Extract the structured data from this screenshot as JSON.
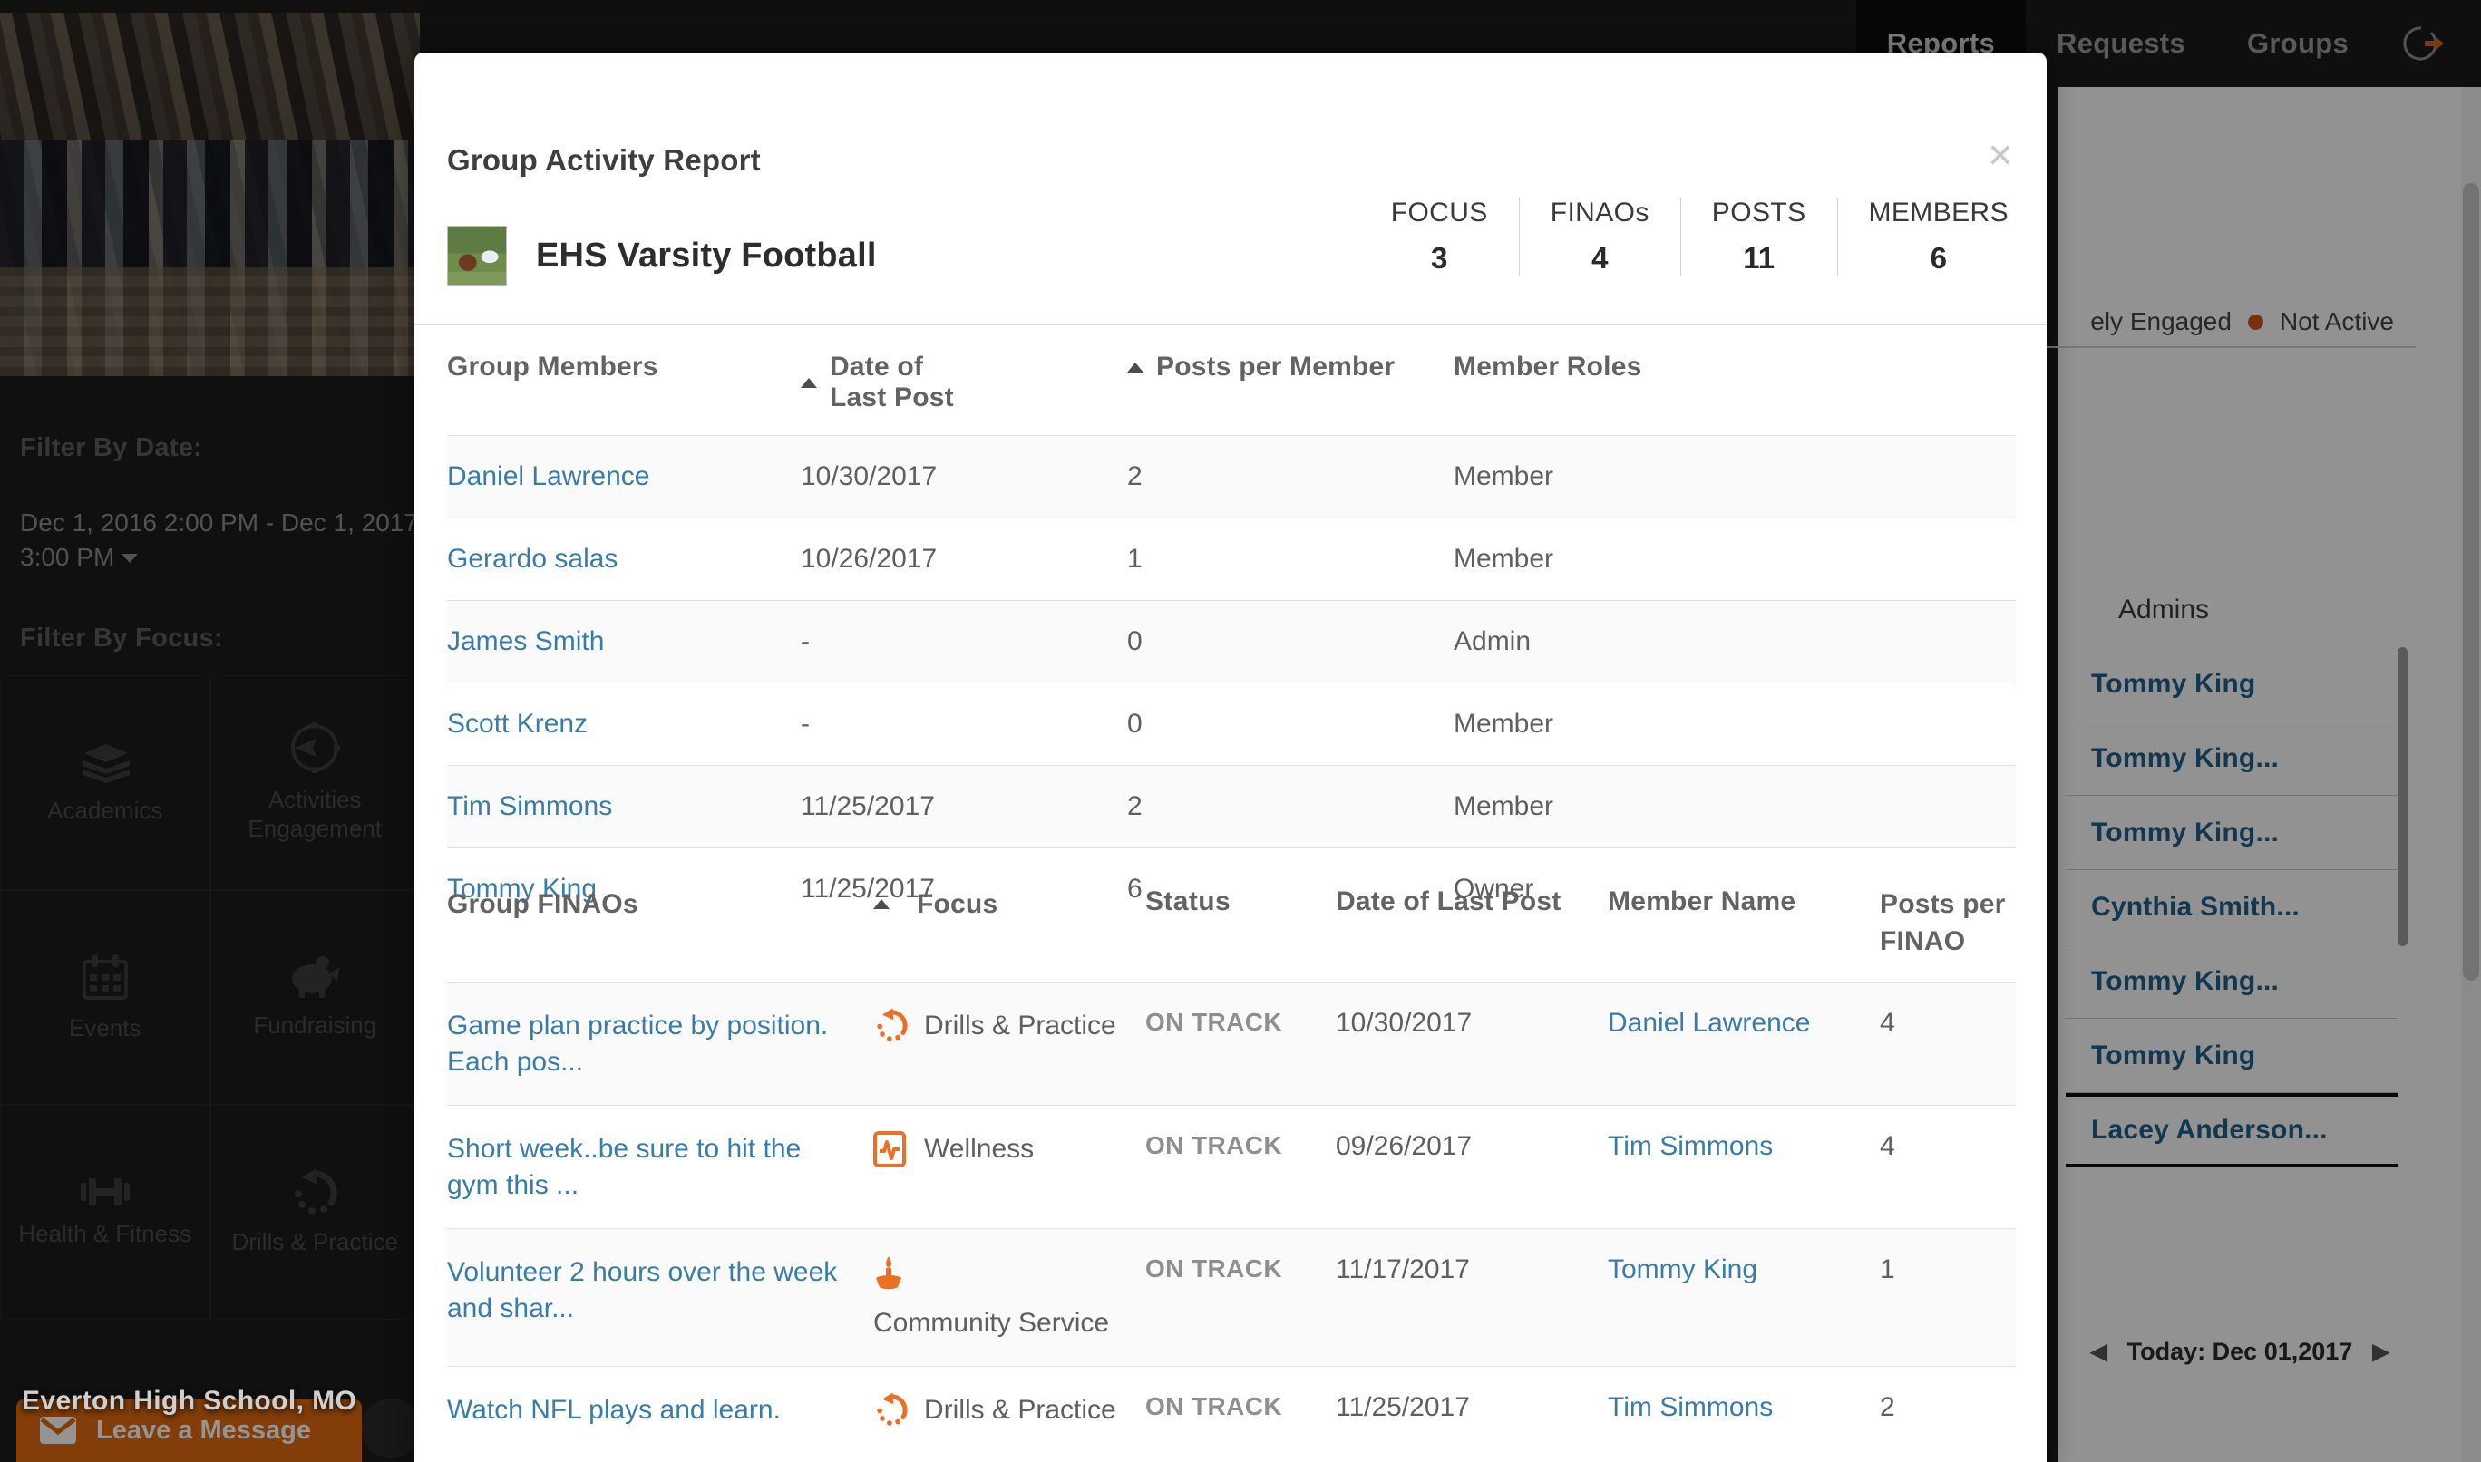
{
  "topnav": {
    "tabs": [
      {
        "label": "Reports",
        "active": true
      },
      {
        "label": "Requests",
        "active": false
      },
      {
        "label": "Groups",
        "active": false
      }
    ],
    "logout_icon": "logout-icon"
  },
  "left": {
    "banner_title": "Everton High School, MO",
    "filter_date_label": "Filter By Date:",
    "filter_date_value": "Dec 1, 2016 2:00 PM - Dec 1, 2017 3:00 PM",
    "filter_focus_label": "Filter By Focus:",
    "focus_items": [
      {
        "label": "Academics",
        "icon": "books-icon"
      },
      {
        "label": "Activities Engagement",
        "icon": "compass-icon"
      },
      {
        "label": "Events",
        "icon": "calendar-icon"
      },
      {
        "label": "Fundraising",
        "icon": "piggy-bank-icon"
      },
      {
        "label": "Health & Fitness",
        "icon": "dumbbell-icon"
      },
      {
        "label": "Drills & Practice",
        "icon": "circular-arrow-icon"
      }
    ],
    "leave_message": "Leave a Message",
    "leave_message_icon": "envelope-icon"
  },
  "right": {
    "legend": [
      {
        "label": "ely Engaged",
        "dot": false
      },
      {
        "label": "Not Active",
        "dot": true,
        "color": "#d2521a"
      }
    ],
    "admins_title": "Admins",
    "admins": [
      {
        "name": "Tommy King"
      },
      {
        "name": "Tommy King..."
      },
      {
        "name": "Tommy King..."
      },
      {
        "name": "Cynthia Smith..."
      },
      {
        "name": "Tommy King..."
      },
      {
        "name": "Tommy King"
      },
      {
        "name": "Lacey Anderson..."
      }
    ],
    "today_label": "Today: Dec 01,2017",
    "prev_icon": "chevron-left-icon",
    "next_icon": "chevron-right-icon"
  },
  "modal": {
    "title": "Group Activity Report",
    "close_icon": "close-icon",
    "group_name": "EHS Varsity Football",
    "group_thumb_icon": "football-thumbnail",
    "stats": [
      {
        "label": "FOCUS",
        "value": "3"
      },
      {
        "label": "FINAOs",
        "value": "4"
      },
      {
        "label": "POSTS",
        "value": "11"
      },
      {
        "label": "MEMBERS",
        "value": "6"
      }
    ],
    "members_table": {
      "headers": [
        "Group Members",
        "Date of Last Post",
        "Posts per Member",
        "Member Roles"
      ],
      "sort_indicators": [
        false,
        true,
        true,
        false
      ],
      "rows": [
        {
          "name": "Daniel Lawrence",
          "date": "10/30/2017",
          "posts": "2",
          "role": "Member"
        },
        {
          "name": "Gerardo salas",
          "date": "10/26/2017",
          "posts": "1",
          "role": "Member"
        },
        {
          "name": "James Smith",
          "date": "-",
          "posts": "0",
          "role": "Admin"
        },
        {
          "name": "Scott Krenz",
          "date": "-",
          "posts": "0",
          "role": "Member"
        },
        {
          "name": "Tim Simmons",
          "date": "11/25/2017",
          "posts": "2",
          "role": "Member"
        },
        {
          "name": "Tommy King",
          "date": "11/25/2017",
          "posts": "6",
          "role": "Owner"
        }
      ]
    },
    "finao_table": {
      "headers": [
        "Group FINAOs",
        "Focus",
        "Status",
        "Date of Last Post",
        "Member Name",
        "Posts per FINAO"
      ],
      "rows": [
        {
          "text": "Game plan practice by position. Each pos...",
          "focus": "Drills & Practice",
          "focus_icon": "circular-arrow-icon",
          "status": "ON TRACK",
          "date": "10/30/2017",
          "member": "Daniel Lawrence",
          "posts": "4"
        },
        {
          "text": "Short week..be sure to hit the gym this ...",
          "focus": "Wellness",
          "focus_icon": "heartbeat-icon",
          "status": "ON TRACK",
          "date": "09/26/2017",
          "member": "Tim Simmons",
          "posts": "4"
        },
        {
          "text": "Volunteer 2 hours over the week and shar...",
          "focus": "Community Service",
          "focus_icon": "volunteer-hand-icon",
          "status": "ON TRACK",
          "date": "11/17/2017",
          "member": "Tommy King",
          "posts": "1"
        },
        {
          "text": "Watch NFL plays and learn.",
          "focus": "Drills & Practice",
          "focus_icon": "circular-arrow-icon",
          "status": "ON TRACK",
          "date": "11/25/2017",
          "member": "Tim Simmons",
          "posts": "2"
        }
      ]
    }
  }
}
